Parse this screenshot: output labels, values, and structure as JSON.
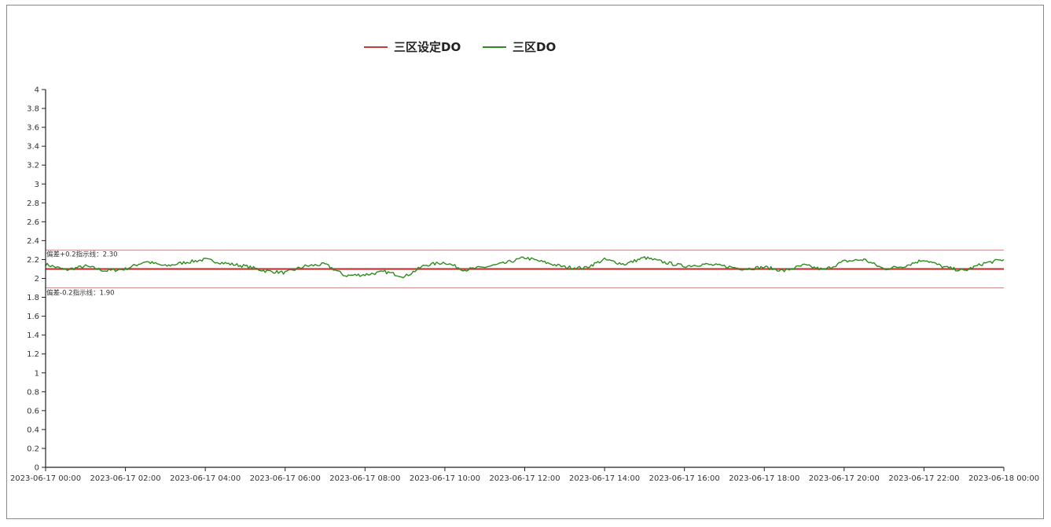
{
  "chart_data": {
    "type": "line",
    "title": "",
    "xlabel": "",
    "ylabel": "",
    "ylim": [
      0,
      4
    ],
    "yticks": [
      0,
      0.2,
      0.4,
      0.6,
      0.8,
      1,
      1.2,
      1.4,
      1.6,
      1.8,
      2,
      2.2,
      2.4,
      2.6,
      2.8,
      3,
      3.2,
      3.4,
      3.6,
      3.8,
      4
    ],
    "xlim": [
      "2023-06-17 00:00",
      "2023-06-18 00:00"
    ],
    "xticks": [
      "2023-06-17 00:00",
      "2023-06-17 02:00",
      "2023-06-17 04:00",
      "2023-06-17 06:00",
      "2023-06-17 08:00",
      "2023-06-17 10:00",
      "2023-06-17 12:00",
      "2023-06-17 14:00",
      "2023-06-17 16:00",
      "2023-06-17 18:00",
      "2023-06-17 20:00",
      "2023-06-17 22:00",
      "2023-06-18 00:00"
    ],
    "grid": false,
    "legend": "top-center",
    "series": [
      {
        "name": "三区设定DO",
        "color": "#c43b3b",
        "x": [
          "2023-06-17 00:00",
          "2023-06-18 00:00"
        ],
        "values": [
          2.1,
          2.1
        ]
      },
      {
        "name": "三区DO",
        "color": "#2e8b1f",
        "x": [
          "2023-06-17 00:00",
          "2023-06-17 00:30",
          "2023-06-17 01:00",
          "2023-06-17 01:30",
          "2023-06-17 02:00",
          "2023-06-17 02:30",
          "2023-06-17 03:00",
          "2023-06-17 03:30",
          "2023-06-17 04:00",
          "2023-06-17 04:30",
          "2023-06-17 05:00",
          "2023-06-17 05:30",
          "2023-06-17 06:00",
          "2023-06-17 06:30",
          "2023-06-17 07:00",
          "2023-06-17 07:30",
          "2023-06-17 08:00",
          "2023-06-17 08:30",
          "2023-06-17 09:00",
          "2023-06-17 09:30",
          "2023-06-17 10:00",
          "2023-06-17 10:30",
          "2023-06-17 11:00",
          "2023-06-17 11:30",
          "2023-06-17 12:00",
          "2023-06-17 12:30",
          "2023-06-17 13:00",
          "2023-06-17 13:30",
          "2023-06-17 14:00",
          "2023-06-17 14:30",
          "2023-06-17 15:00",
          "2023-06-17 15:30",
          "2023-06-17 16:00",
          "2023-06-17 16:30",
          "2023-06-17 17:00",
          "2023-06-17 17:30",
          "2023-06-17 18:00",
          "2023-06-17 18:30",
          "2023-06-17 19:00",
          "2023-06-17 19:30",
          "2023-06-17 20:00",
          "2023-06-17 20:30",
          "2023-06-17 21:00",
          "2023-06-17 21:30",
          "2023-06-17 22:00",
          "2023-06-17 22:30",
          "2023-06-17 23:00",
          "2023-06-17 23:30",
          "2023-06-18 00:00"
        ],
        "values": [
          2.15,
          2.09,
          2.13,
          2.08,
          2.1,
          2.18,
          2.13,
          2.17,
          2.2,
          2.16,
          2.13,
          2.08,
          2.06,
          2.13,
          2.15,
          2.03,
          2.04,
          2.07,
          2.02,
          2.14,
          2.17,
          2.09,
          2.12,
          2.16,
          2.22,
          2.17,
          2.12,
          2.11,
          2.2,
          2.15,
          2.22,
          2.17,
          2.13,
          2.15,
          2.13,
          2.1,
          2.12,
          2.08,
          2.14,
          2.09,
          2.18,
          2.2,
          2.1,
          2.13,
          2.2,
          2.12,
          2.08,
          2.16,
          2.2
        ]
      }
    ],
    "reference_lines": [
      {
        "label": "偏差+0.2指示线：2.30",
        "value": 2.3,
        "color": "#c98a8a"
      },
      {
        "label": "偏差-0.2指示线：1.90",
        "value": 1.9,
        "color": "#c98a8a"
      }
    ]
  }
}
